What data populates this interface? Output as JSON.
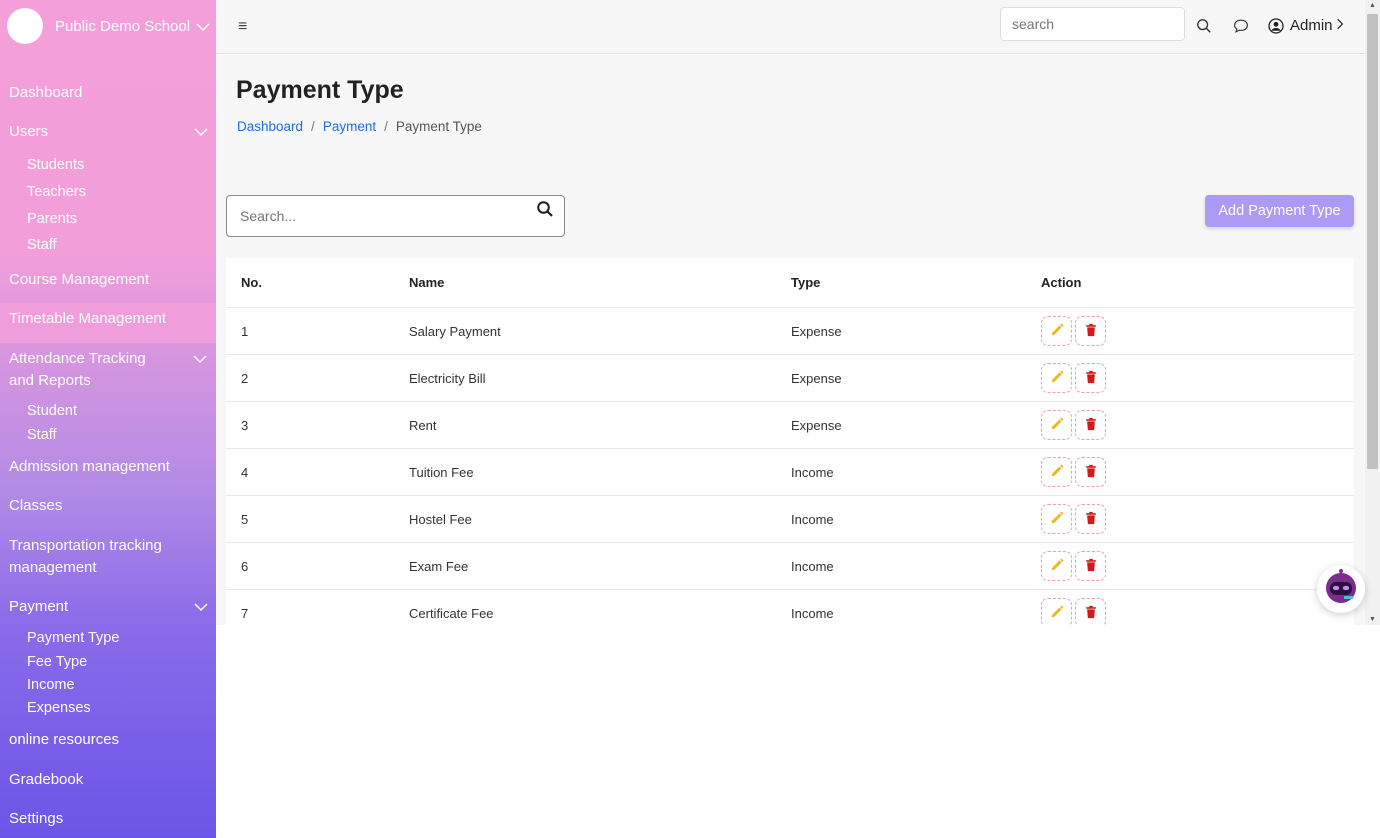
{
  "sidebar": {
    "school_name": "Public Demo School",
    "items": [
      {
        "label": "Dashboard"
      },
      {
        "label": "Users"
      },
      {
        "label": "Course Management"
      },
      {
        "label": "Timetable Management"
      },
      {
        "label": "Attendance Tracking and Reports"
      },
      {
        "label": "Admission management"
      },
      {
        "label": "Classes"
      },
      {
        "label": "Transportation tracking management"
      },
      {
        "label": "Payment"
      },
      {
        "label": "online resources"
      },
      {
        "label": "Gradebook"
      },
      {
        "label": "Settings"
      }
    ],
    "users_sub": [
      "Students",
      "Teachers",
      "Parents",
      "Staff"
    ],
    "attendance_sub": [
      "Student",
      "Staff"
    ],
    "payment_sub": [
      "Payment Type",
      "Fee Type",
      "Income",
      "Expenses"
    ]
  },
  "topbar": {
    "search_placeholder": "search",
    "user_label": "Admin"
  },
  "page": {
    "title": "Payment Type",
    "breadcrumb": [
      "Dashboard",
      "Payment",
      "Payment Type"
    ],
    "search_placeholder": "Search...",
    "add_button": "Add Payment Type"
  },
  "table": {
    "headers": [
      "No.",
      "Name",
      "Type",
      "Action"
    ],
    "rows": [
      {
        "no": "1",
        "name": "Salary Payment",
        "type": "Expense"
      },
      {
        "no": "2",
        "name": "Electricity Bill",
        "type": "Expense"
      },
      {
        "no": "3",
        "name": "Rent",
        "type": "Expense"
      },
      {
        "no": "4",
        "name": "Tuition Fee",
        "type": "Income"
      },
      {
        "no": "5",
        "name": "Hostel Fee",
        "type": "Income"
      },
      {
        "no": "6",
        "name": "Exam Fee",
        "type": "Income"
      },
      {
        "no": "7",
        "name": "Certificate Fee",
        "type": "Income"
      }
    ]
  },
  "icons": {
    "edit": "pencil-icon",
    "delete": "trash-icon",
    "search": "search-icon",
    "chat": "chat-icon",
    "user": "user-circle-icon",
    "assistant": "robot-icon"
  },
  "colors": {
    "accent": "#ab9bf4",
    "link": "#1c6fe0",
    "edit_icon": "#e8b923",
    "delete_icon": "#d11a1a"
  }
}
